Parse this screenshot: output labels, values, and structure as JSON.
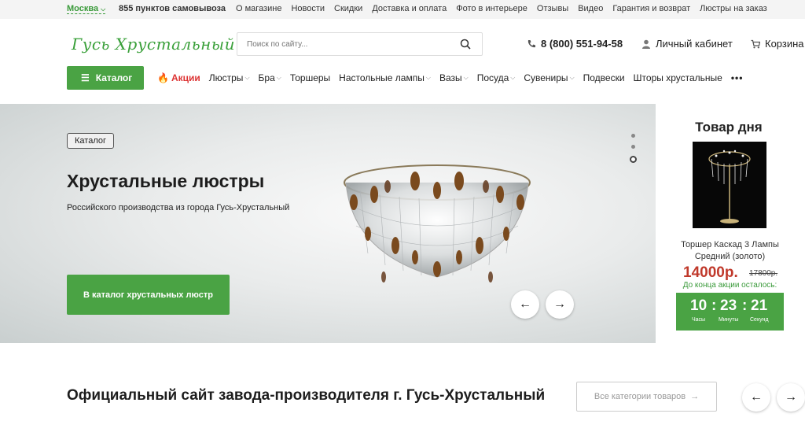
{
  "topbar": {
    "city": "Москва",
    "pickup": "855 пунктов самовывоза",
    "links": [
      "О магазине",
      "Новости",
      "Скидки",
      "Доставка и оплата",
      "Фото в интерьере",
      "Отзывы",
      "Видео",
      "Гарантия и возврат",
      "Люстры на заказ"
    ]
  },
  "header": {
    "logo_text": "Гусь Хрустальный",
    "search_placeholder": "Поиск по сайту...",
    "phone": "8 (800) 551-94-58",
    "account": "Личный кабинет",
    "cart": "Корзина"
  },
  "nav": {
    "catalog": "Каталог",
    "sales": "Акции",
    "items": [
      "Люстры",
      "Бра",
      "Торшеры",
      "Настольные лампы",
      "Вазы",
      "Посуда",
      "Сувениры",
      "Подвески",
      "Шторы хрустальные"
    ],
    "more": "•••"
  },
  "hero": {
    "badge": "Каталог",
    "title": "Хрустальные люстры",
    "subtitle": "Российского производства из города Гусь-Хрустальный",
    "button": "В каталог хрустальных люстр",
    "prev": "←",
    "next": "→"
  },
  "product_of_day": {
    "title": "Товар дня",
    "name": "Торшер Каскад 3 Лампы Средний (золото)",
    "price": "14000р.",
    "old_price": "17800р.",
    "until": "До конца акции осталось:",
    "hours": "10",
    "minutes": "23",
    "seconds": "21",
    "hours_label": "Часы",
    "minutes_label": "Минуты",
    "seconds_label": "Секунд"
  },
  "section": {
    "title": "Официальный сайт завода-производителя г. Гусь-Хрустальный",
    "all_categories": "Все категории товаров",
    "prev": "←",
    "next": "→"
  },
  "colors": {
    "accent": "#4aa344",
    "sale": "#d33333",
    "price": "#c0392b"
  }
}
